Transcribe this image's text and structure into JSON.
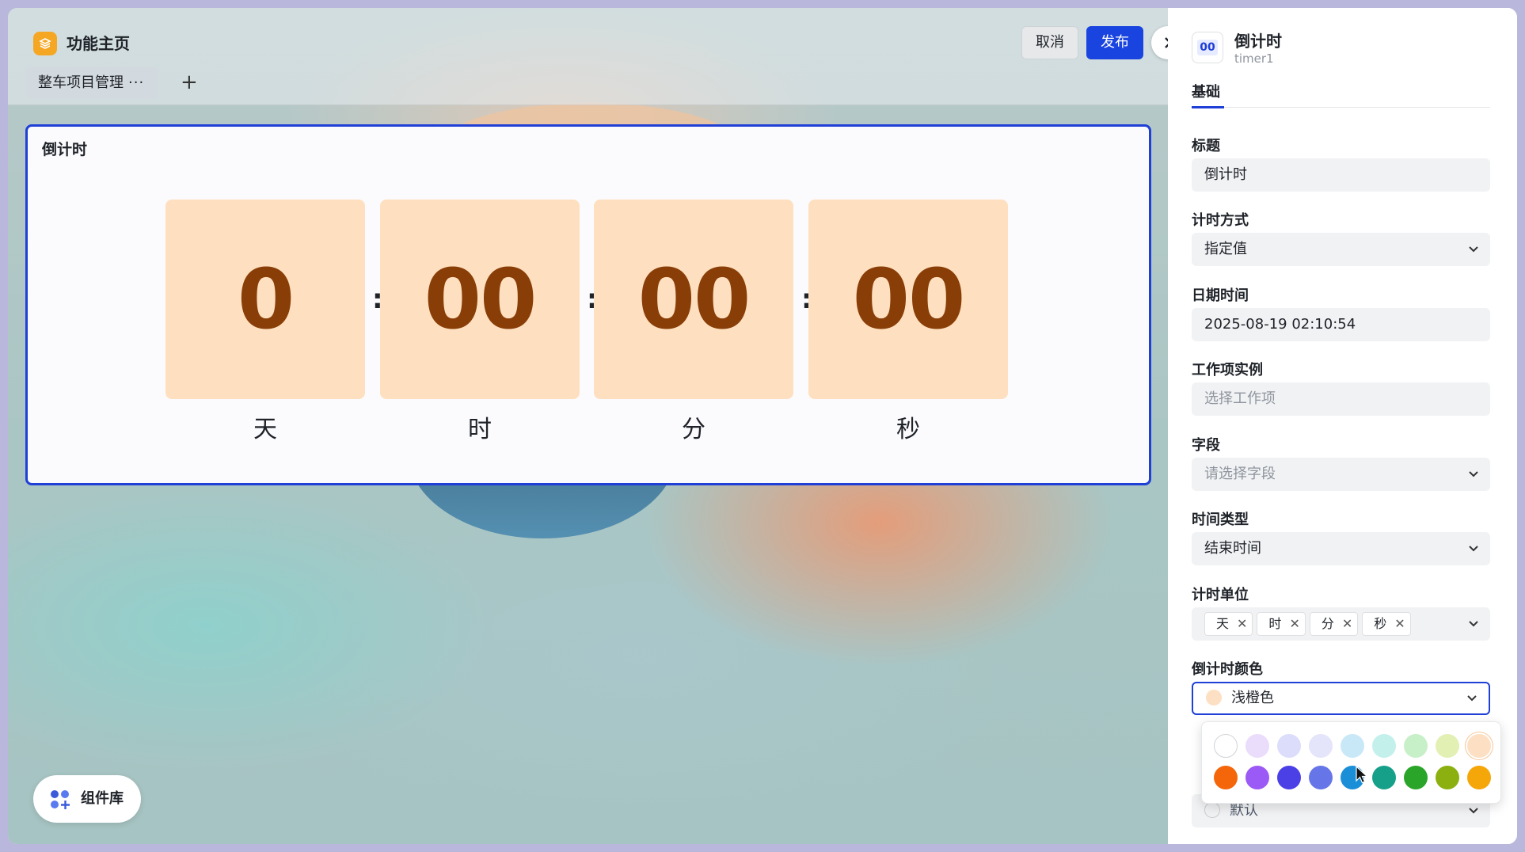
{
  "header": {
    "app_title": "功能主页",
    "tab_label": "整车项目管理",
    "tab_more": "···",
    "add_tab": "+",
    "cancel_label": "取消",
    "publish_label": "发布",
    "collapse_icon": "chevron-right-icon"
  },
  "widget": {
    "title": "倒计时",
    "values": [
      "0",
      "00",
      "00",
      "00"
    ],
    "separator": ":",
    "units": [
      "天",
      "时",
      "分",
      "秒"
    ],
    "cell_color": "#fee0c0",
    "digit_color": "#8a3e07",
    "border_color": "#1f3fd6"
  },
  "component_library": {
    "label": "组件库"
  },
  "panel": {
    "icon_text": "00",
    "title": "倒计时",
    "subtitle": "timer1",
    "tab": "基础",
    "fields": {
      "title_label": "标题",
      "title_value": "倒计时",
      "mode_label": "计时方式",
      "mode_value": "指定值",
      "datetime_label": "日期时间",
      "datetime_value": "2025-08-19 02:10:54",
      "workitem_label": "工作项实例",
      "workitem_placeholder": "选择工作项",
      "field_label": "字段",
      "field_placeholder": "请选择字段",
      "timetype_label": "时间类型",
      "timetype_value": "结束时间",
      "unit_label": "计时单位",
      "unit_tags": [
        "天",
        "时",
        "分",
        "秒"
      ],
      "color_label": "倒计时颜色",
      "color_value": "浅橙色",
      "next_value": "默认"
    },
    "palette_row1": [
      "#ffffff",
      "#eadcfb",
      "#dcdcfb",
      "#e4e4fa",
      "#c8e8f8",
      "#c4f0ec",
      "#c8f0c8",
      "#e2f0b4",
      "#fde0c4"
    ],
    "palette_row2": [
      "#f5660a",
      "#9b59f5",
      "#4b3fe6",
      "#6676e8",
      "#1a8fd8",
      "#16a089",
      "#2aa52a",
      "#8cb010",
      "#f5a70a"
    ],
    "accent": "#1f3fd6"
  }
}
